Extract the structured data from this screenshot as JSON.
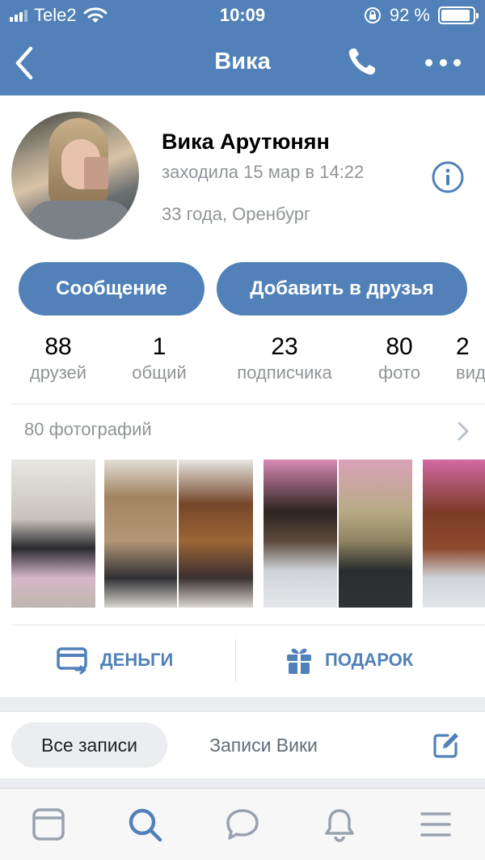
{
  "status_bar": {
    "carrier": "Tele2",
    "time": "10:09",
    "battery": "92 %",
    "battery_level": 0.92
  },
  "nav": {
    "title": "Вика",
    "back_icon": "chevron-left-icon",
    "call_icon": "phone-icon",
    "more_icon": "more-dots-icon"
  },
  "profile": {
    "name": "Вика Арутюнян",
    "last_seen": "заходила 15 мар в 14:22",
    "age_location": "33 года, Оренбург"
  },
  "buttons": {
    "message": "Сообщение",
    "add_friend": "Добавить в друзья"
  },
  "counters": [
    {
      "num": "88",
      "label": "друзей"
    },
    {
      "num": "1",
      "label": "общий"
    },
    {
      "num": "23",
      "label": "подписчика"
    },
    {
      "num": "80",
      "label": "фото"
    },
    {
      "num": "2",
      "label": "вид"
    }
  ],
  "photos": {
    "header": "80 фотографий"
  },
  "actions": {
    "money": "ДЕНЬГИ",
    "gift": "ПОДАРОК"
  },
  "wall": {
    "tab_all": "Все записи",
    "tab_own": "Записи Вики"
  },
  "colors": {
    "accent": "#5181b8",
    "secondary_text": "#909499",
    "background_gray": "#ebedf0"
  },
  "tabbar": [
    "news-icon",
    "search-icon",
    "messages-icon",
    "notifications-icon",
    "menu-icon"
  ]
}
